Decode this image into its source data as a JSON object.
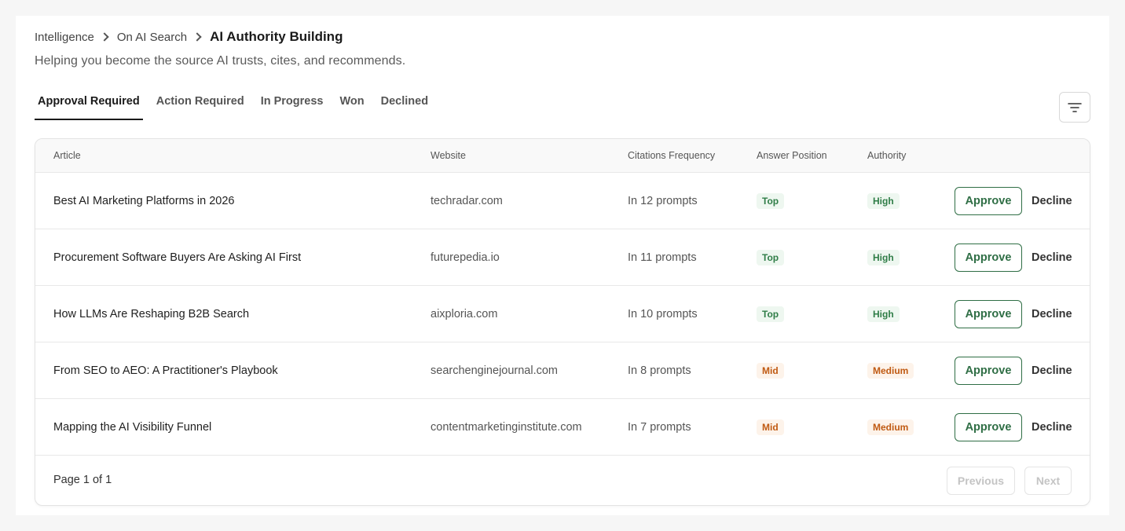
{
  "breadcrumb": {
    "items": [
      "Intelligence",
      "On AI Search"
    ],
    "current": "AI Authority Building"
  },
  "subtitle": "Helping you become the source AI trusts, cites, and recommends.",
  "tabs": [
    {
      "label": "Approval Required",
      "active": true
    },
    {
      "label": "Action Required",
      "active": false
    },
    {
      "label": "In Progress",
      "active": false
    },
    {
      "label": "Won",
      "active": false
    },
    {
      "label": "Declined",
      "active": false
    }
  ],
  "icons": {
    "filter": "filter-lines-icon"
  },
  "colors": {
    "accent": "#2f6e45",
    "badge_green": "#2f7d47",
    "badge_orange": "#c05a12"
  },
  "table": {
    "columns": [
      "Article",
      "Website",
      "Citations Frequency",
      "Answer Position",
      "Authority"
    ],
    "rows": [
      {
        "article": "Best AI Marketing Platforms in 2026",
        "website": "techradar.com",
        "citations": "In 12 prompts",
        "position": "Top",
        "authority": "High",
        "approve": "Approve",
        "decline": "Decline"
      },
      {
        "article": "Procurement Software Buyers Are Asking AI First",
        "website": "futurepedia.io",
        "citations": "In 11 prompts",
        "position": "Top",
        "authority": "High",
        "approve": "Approve",
        "decline": "Decline"
      },
      {
        "article": "How LLMs Are Reshaping B2B Search",
        "website": "aixploria.com",
        "citations": "In 10 prompts",
        "position": "Top",
        "authority": "High",
        "approve": "Approve",
        "decline": "Decline"
      },
      {
        "article": "From SEO to AEO: A Practitioner's Playbook",
        "website": "searchenginejournal.com",
        "citations": "In 8 prompts",
        "position": "Mid",
        "authority": "Medium",
        "approve": "Approve",
        "decline": "Decline"
      },
      {
        "article": "Mapping the AI Visibility Funnel",
        "website": "contentmarketinginstitute.com",
        "citations": "In 7 prompts",
        "position": "Mid",
        "authority": "Medium",
        "approve": "Approve",
        "decline": "Decline"
      }
    ]
  },
  "pagination": {
    "info": "Page 1 of 1",
    "previous": "Previous",
    "next": "Next"
  }
}
